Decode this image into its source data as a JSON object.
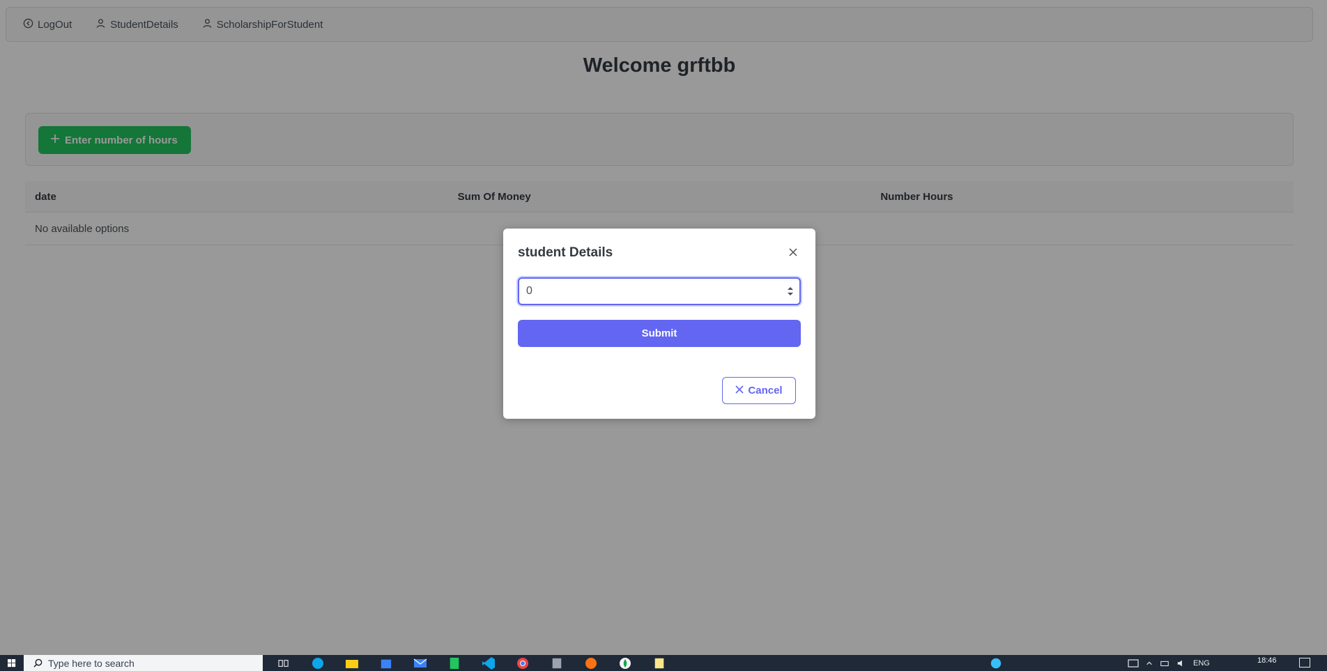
{
  "nav": {
    "items": [
      {
        "label": "LogOut",
        "icon": "logout-icon"
      },
      {
        "label": "StudentDetails",
        "icon": "user-icon"
      },
      {
        "label": "ScholarshipForStudent",
        "icon": "user-icon"
      }
    ]
  },
  "welcome": "Welcome grftbb",
  "toolbar": {
    "add_label": "Enter number of hours",
    "add_icon": "plus-icon"
  },
  "table": {
    "columns": [
      "date",
      "Sum Of Money",
      "Number Hours"
    ],
    "empty_message": "No available options"
  },
  "dialog": {
    "title": "student Details",
    "input_value": "0",
    "submit_label": "Submit",
    "cancel_label": "Cancel"
  },
  "taskbar": {
    "search_placeholder": "Type here to search",
    "language": "ENG",
    "time": "18:46"
  },
  "colors": {
    "accent": "#6366f1",
    "success": "#22c55e",
    "taskbar": "#1f2937"
  }
}
